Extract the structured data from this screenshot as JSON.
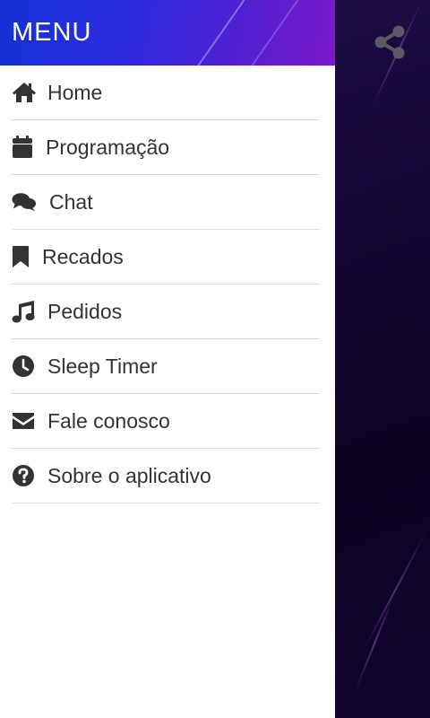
{
  "drawer": {
    "title": "MENU",
    "items": [
      {
        "label": "Home",
        "icon": "home-icon"
      },
      {
        "label": "Programação",
        "icon": "calendar-icon"
      },
      {
        "label": "Chat",
        "icon": "chat-bubbles-icon"
      },
      {
        "label": "Recados",
        "icon": "bookmark-icon"
      },
      {
        "label": "Pedidos",
        "icon": "music-note-icon"
      },
      {
        "label": "Sleep Timer",
        "icon": "clock-icon"
      },
      {
        "label": "Fale conosco",
        "icon": "envelope-icon"
      },
      {
        "label": "Sobre o aplicativo",
        "icon": "question-circle-icon"
      }
    ]
  },
  "toolbar": {
    "share_icon": "share-icon"
  },
  "colors": {
    "header_gradient_start": "#1530d4",
    "header_gradient_end": "#7a18c8",
    "background_dark": "#120530",
    "icon_color": "#333333",
    "share_icon_color": "#5a5a66"
  }
}
